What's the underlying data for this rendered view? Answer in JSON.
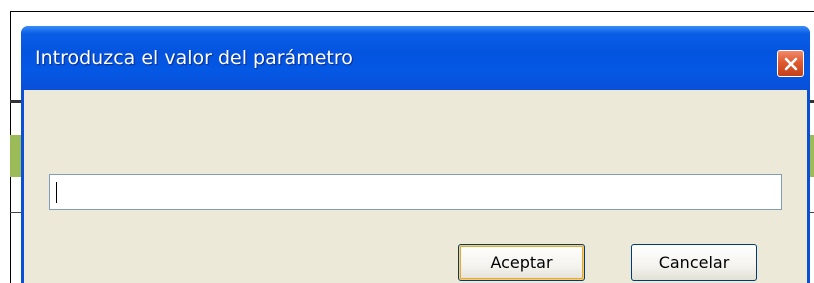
{
  "dialog": {
    "title": "Introduzca el valor del parámetro",
    "close_icon": "close-icon",
    "input_value": "",
    "ok_label": "Aceptar",
    "cancel_label": "Cancelar"
  },
  "colors": {
    "title_bar": "#0454e0",
    "client_bg": "#ece9d8",
    "close_button": "#e05a30",
    "background_band": "#9bbb59"
  }
}
